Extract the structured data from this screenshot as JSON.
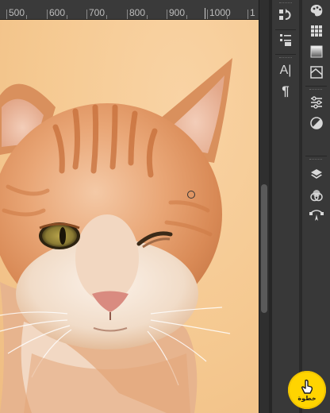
{
  "ruler": {
    "labels": [
      "500",
      "600",
      "700",
      "800",
      "900",
      "1000",
      "1"
    ]
  },
  "document": {
    "subject": "orange tabby cat winking"
  },
  "panel_icons": {
    "column_a": [
      "history-icon",
      "properties-icon",
      "character-icon",
      "paragraph-icon"
    ],
    "column_b": [
      "color-icon",
      "swatches-icon",
      "gradients-icon",
      "adjustments-icon",
      "contrast-icon",
      "layers-icon",
      "channels-icon",
      "paths-icon"
    ],
    "character_glyph": "A|",
    "paragraph_glyph": "¶"
  },
  "badge": {
    "text": "خطوة"
  },
  "colors": {
    "canvas_bg": "#f5c993",
    "panel_bg": "#383838",
    "badge": "#ffd400"
  }
}
